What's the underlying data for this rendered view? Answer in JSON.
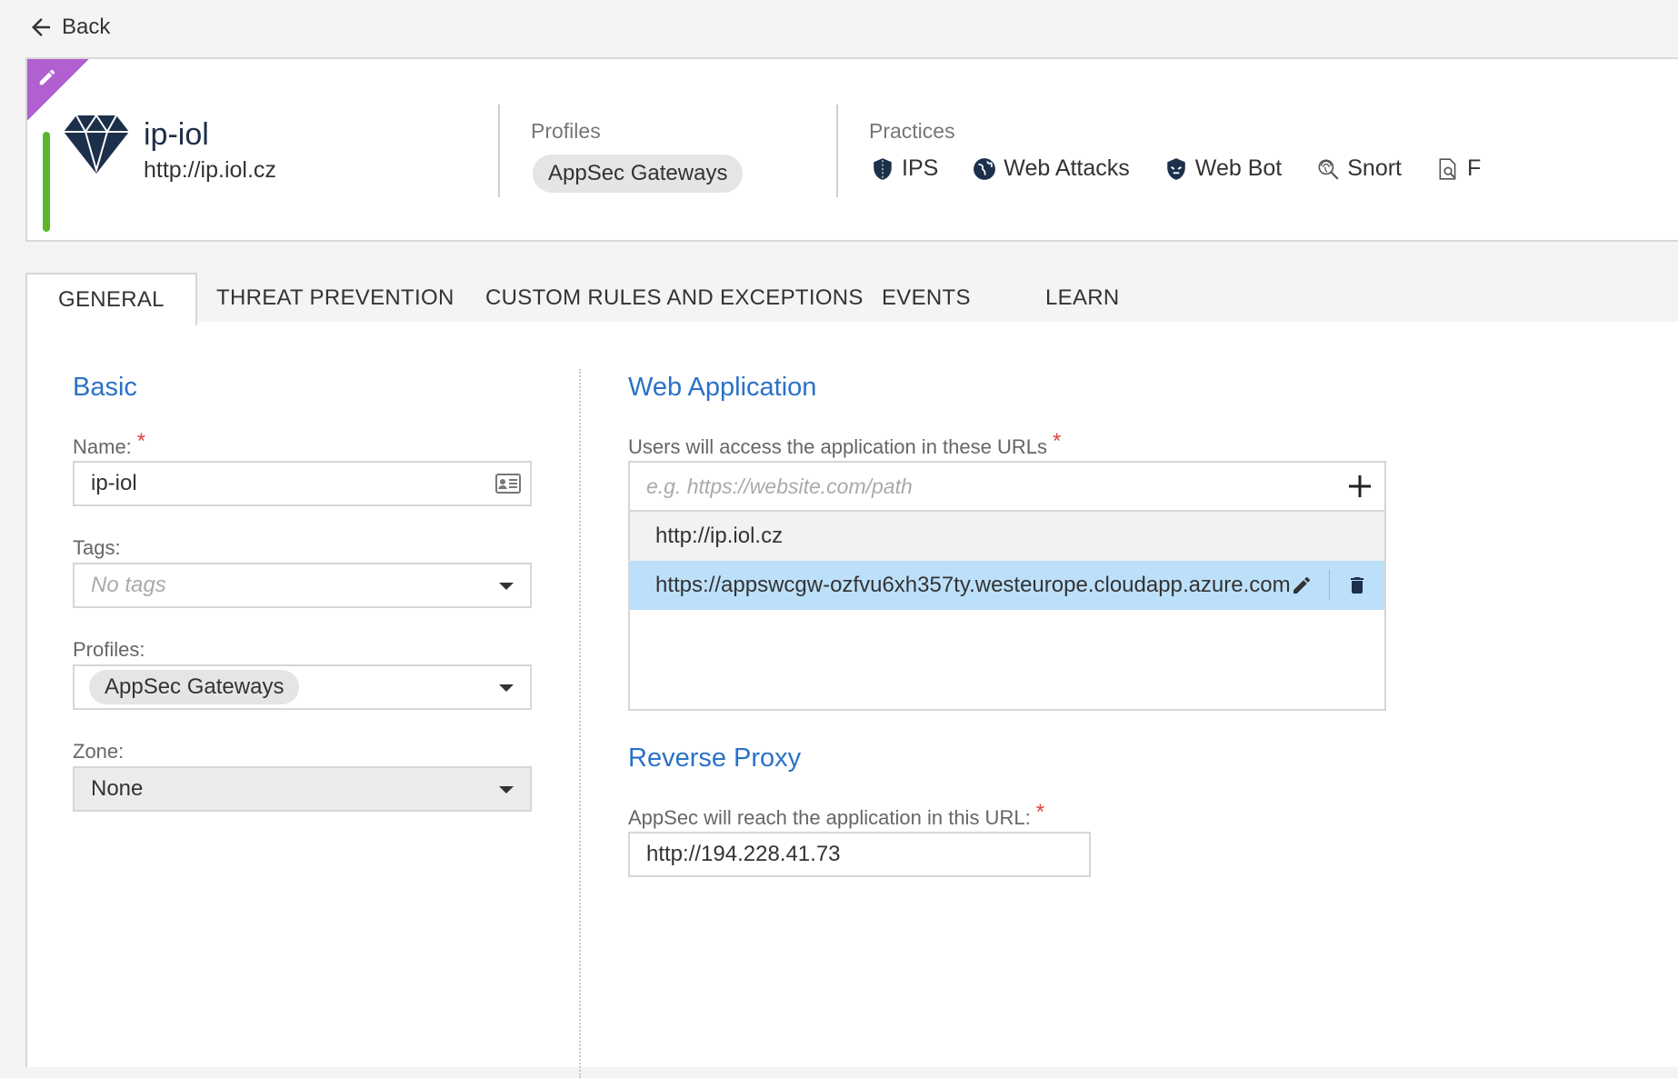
{
  "nav": {
    "back_label": "Back"
  },
  "asset": {
    "name": "ip-iol",
    "url": "http://ip.iol.cz",
    "status_color": "#5cb82a",
    "edit_corner_color": "#b060d0"
  },
  "header": {
    "profiles_label": "Profiles",
    "profile_chip": "AppSec Gateways",
    "practices_label": "Practices",
    "practices": [
      {
        "label": "IPS",
        "icon": "shield-pattern-icon"
      },
      {
        "label": "Web Attacks",
        "icon": "globe-icon"
      },
      {
        "label": "Web Bot",
        "icon": "bot-shield-icon"
      },
      {
        "label": "Snort",
        "icon": "fingerprint-icon"
      },
      {
        "label": "F",
        "icon": "document-search-icon"
      }
    ]
  },
  "tabs": [
    {
      "label": "GENERAL",
      "active": true
    },
    {
      "label": "THREAT PREVENTION",
      "active": false
    },
    {
      "label": "CUSTOM RULES AND EXCEPTIONS",
      "active": false
    },
    {
      "label": "EVENTS",
      "active": false
    },
    {
      "label": "LEARN",
      "active": false
    }
  ],
  "basic": {
    "title": "Basic",
    "name_label": "Name:",
    "name_value": "ip-iol",
    "tags_label": "Tags:",
    "tags_placeholder": "No tags",
    "profiles_label": "Profiles:",
    "profiles_chip": "AppSec Gateways",
    "zone_label": "Zone:",
    "zone_value": "None"
  },
  "web_app": {
    "title": "Web Application",
    "urls_label": "Users will access the application in these URLs",
    "url_placeholder": "e.g. https://website.com/path",
    "urls": [
      "http://ip.iol.cz",
      "https://appswcgw-ozfvu6xh357ty.westeurope.cloudapp.azure.com"
    ]
  },
  "reverse_proxy": {
    "title": "Reverse Proxy",
    "url_label": "AppSec will reach the application in this URL:",
    "url_value": "http://194.228.41.73"
  },
  "required_marker": "*",
  "colors": {
    "accent": "#2a72c6",
    "required": "#e0433a",
    "selected_row": "#bde0fa",
    "icon_dark": "#1c2f4b"
  }
}
